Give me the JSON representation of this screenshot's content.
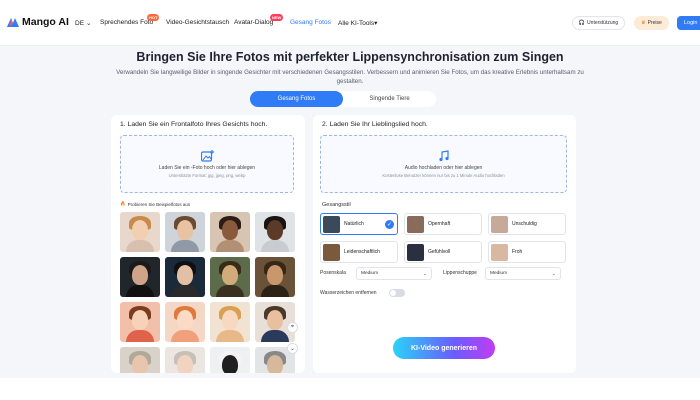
{
  "nav": {
    "logo": "Mango AI",
    "language": "DE",
    "links": [
      {
        "label": "Sprechendes Foto",
        "badge": "HOT"
      },
      {
        "label": "Video-Gesichtstausch"
      },
      {
        "label": "Avatar-Dialog",
        "badge": "NEW"
      },
      {
        "label": "Gesang Fotos",
        "active": true
      },
      {
        "label": "Alle KI-Tools"
      }
    ],
    "support": "Unterstützung",
    "prices": "Preise",
    "login": "Login"
  },
  "hero": {
    "title": "Bringen Sie Ihre Fotos mit perfekter Lippensynchronisation zum Singen",
    "subtitle": "Verwandeln Sie langweilige Bilder in singende Gesichter mit verschiedenen Gesangsstilen. Verbessern und animieren Sie Fotos, um das kreative Erlebnis unterhaltsam zu gestalten."
  },
  "tabs": [
    "Gesang Fotos",
    "Singende Tiere"
  ],
  "left": {
    "title": "1. Laden Sie ein Frontalfoto Ihres Gesichts hoch.",
    "upload_main": "Laden Sie ein -Foto hoch oder hier ablegen",
    "upload_hint": "Unterstützte Format: jpg, jpeg, png, webp",
    "examples_label": "Probieren Sie Beispielfotos aus"
  },
  "right": {
    "title": "2. Laden Sie Ihr Lieblingslied hoch.",
    "upload_main": "Audio hochladen oder hier ablegen",
    "upload_hint": "Kostenlose Benutzer können nur bis zu 1 Minute Audio hochladen",
    "style_label": "Gesangsstil",
    "styles": [
      "Natürlich",
      "Opernhaft",
      "Unschuldig",
      "Leidenschaftlich",
      "Gefühlvoll",
      "Froh"
    ],
    "pose_label": "Posenskala",
    "pose_value": "Medium",
    "lip_label": "Lippenschuppe",
    "lip_value": "Medium",
    "watermark_label": "Wasserzeichen entfernen",
    "generate": "KI-Video generieren"
  },
  "colors": {
    "accent": "#2f7cf6",
    "background": "#f5f6fa"
  }
}
